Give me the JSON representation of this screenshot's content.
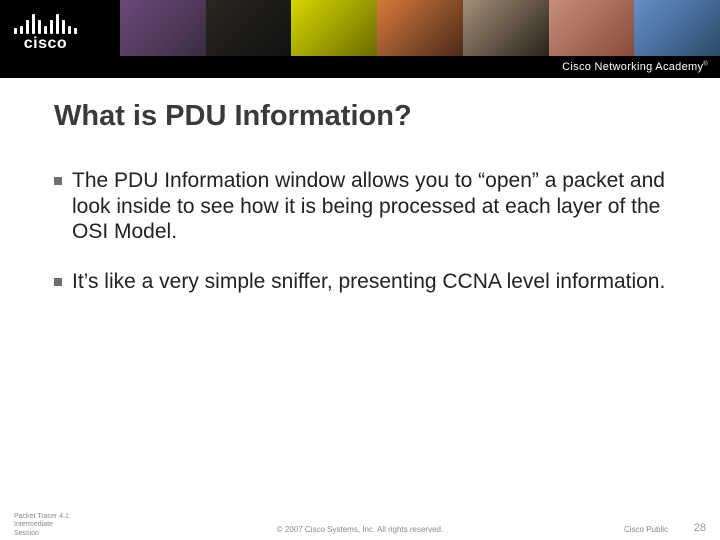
{
  "brand": {
    "name": "cisco",
    "academy": "Cisco Networking Academy",
    "tm": "®"
  },
  "title": "What is PDU Information?",
  "bullets": [
    "The PDU Information window allows you to “open” a packet and look inside to see how it is being processed at each layer of the OSI Model.",
    "It’s like a very simple sniffer, presenting CCNA level information."
  ],
  "footer": {
    "left_line1": "Packet Tracer 4.1:",
    "left_line2": "Intermediate",
    "left_line3": "Session",
    "center": "© 2007 Cisco Systems, Inc. All rights reserved.",
    "right": "Cisco Public",
    "page": "28"
  }
}
